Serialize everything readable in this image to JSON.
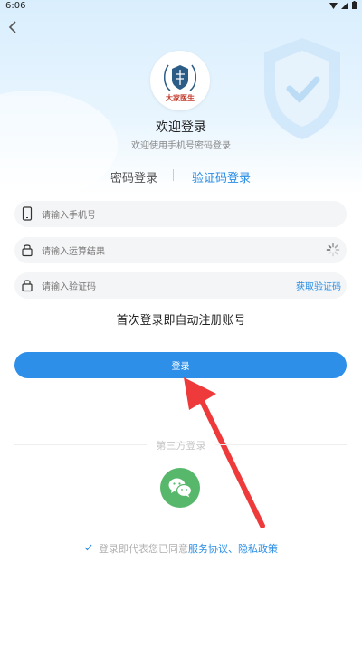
{
  "status_bar": {
    "time": "6:06"
  },
  "header": {
    "logo_alt": "大家医生",
    "title": "欢迎登录",
    "subtitle": "欢迎使用手机号密码登录"
  },
  "tabs": [
    {
      "label": "密码登录",
      "active": false
    },
    {
      "label": "验证码登录",
      "active": true
    }
  ],
  "form": {
    "phone_placeholder": "请输入手机号",
    "captcha_placeholder": "请输入运算结果",
    "sms_placeholder": "请输入验证码",
    "get_code_label": "获取验证码"
  },
  "notice": "首次登录即自动注册账号",
  "login_button": "登录",
  "third_party": {
    "label": "第三方登录",
    "wechat_icon": "wechat-icon"
  },
  "agreement": {
    "checked": true,
    "prefix": "登录即代表您已同意",
    "links": "服务协议、隐私政策"
  },
  "colors": {
    "accent": "#2e8fe8",
    "link": "#2a8ee6",
    "wechat": "#57b86b",
    "arrow": "#ee3a3a"
  }
}
